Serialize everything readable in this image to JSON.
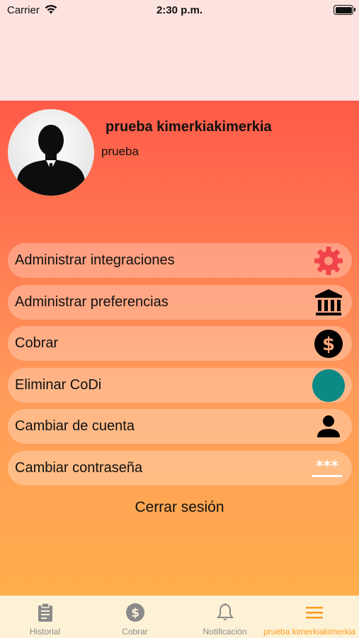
{
  "status_bar": {
    "carrier": "Carrier",
    "time": "2:30 p.m."
  },
  "profile": {
    "name": "prueba kimerkiakimerkia",
    "subtitle": "prueba"
  },
  "menu": [
    {
      "label": "Administrar integraciones",
      "icon": "gear-icon",
      "icon_color": "#f0444a"
    },
    {
      "label": "Administrar preferencias",
      "icon": "bank-icon",
      "icon_color": "#000000"
    },
    {
      "label": "Cobrar",
      "icon": "dollar-circle-icon",
      "icon_color": "#000000"
    },
    {
      "label": "Eliminar CoDi",
      "icon": "teal-circle-icon",
      "icon_color": "#0b8a85"
    },
    {
      "label": "Cambiar de cuenta",
      "icon": "person-icon",
      "icon_color": "#000000"
    },
    {
      "label": "Cambiar contraseña",
      "icon": "password-icon",
      "icon_color": "#ffffff"
    }
  ],
  "logout_label": "Cerrar sesión",
  "tabs": [
    {
      "label": "Historial",
      "icon": "clipboard-icon"
    },
    {
      "label": "Cobrar",
      "icon": "dollar-circle-icon"
    },
    {
      "label": "Notificación",
      "icon": "bell-icon"
    },
    {
      "label": "prueba kimerkiakimerkia",
      "icon": "hamburger-menu-icon",
      "active": true
    }
  ],
  "colors": {
    "accent": "#ff9a1e",
    "gradient_top": "#ff5a48",
    "gradient_bottom": "#ffae4c",
    "tabbar_bg": "#fdf2d6"
  }
}
